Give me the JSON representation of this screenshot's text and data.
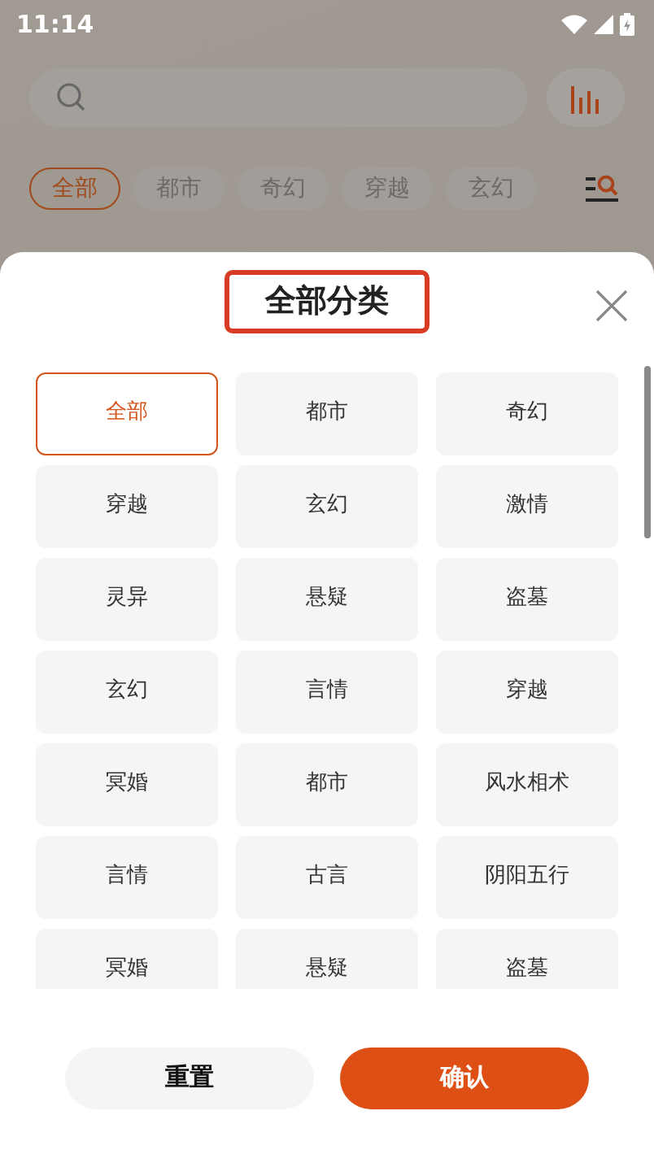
{
  "status_bar": {
    "time": "11:14"
  },
  "chips": [
    {
      "label": "全部",
      "selected": true
    },
    {
      "label": "都市",
      "selected": false
    },
    {
      "label": "奇幻",
      "selected": false
    },
    {
      "label": "穿越",
      "selected": false
    },
    {
      "label": "玄幻",
      "selected": false
    }
  ],
  "sheet": {
    "title": "全部分类",
    "title_highlighted": true,
    "categories": [
      {
        "label": "全部",
        "selected": true
      },
      {
        "label": "都市",
        "selected": false
      },
      {
        "label": "奇幻",
        "selected": false
      },
      {
        "label": "穿越",
        "selected": false
      },
      {
        "label": "玄幻",
        "selected": false
      },
      {
        "label": "激情",
        "selected": false
      },
      {
        "label": "灵异",
        "selected": false
      },
      {
        "label": "悬疑",
        "selected": false
      },
      {
        "label": "盗墓",
        "selected": false
      },
      {
        "label": "玄幻",
        "selected": false
      },
      {
        "label": "言情",
        "selected": false
      },
      {
        "label": "穿越",
        "selected": false
      },
      {
        "label": "冥婚",
        "selected": false
      },
      {
        "label": "都市",
        "selected": false
      },
      {
        "label": "风水相术",
        "selected": false
      },
      {
        "label": "言情",
        "selected": false
      },
      {
        "label": "古言",
        "selected": false
      },
      {
        "label": "阴阳五行",
        "selected": false
      },
      {
        "label": "冥婚",
        "selected": false
      },
      {
        "label": "悬疑",
        "selected": false
      },
      {
        "label": "盗墓",
        "selected": false
      }
    ],
    "buttons": [
      {
        "label": "重置",
        "kind": "secondary"
      },
      {
        "label": "确认",
        "kind": "primary"
      }
    ]
  }
}
